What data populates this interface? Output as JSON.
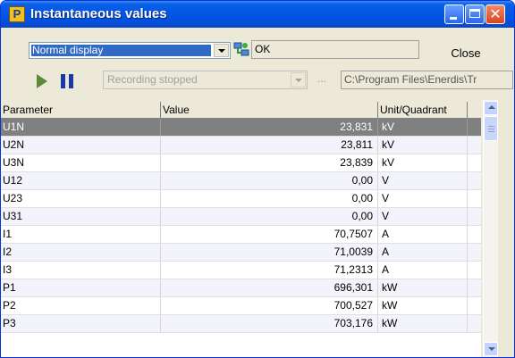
{
  "window": {
    "title": "Instantaneous values",
    "app_icon": "P"
  },
  "toolbar": {
    "display_mode": "Normal display",
    "status": "OK",
    "close_label": "Close",
    "recording_status": "Recording stopped",
    "browse_label": "...",
    "path": "C:\\Program Files\\Enerdis\\Tr"
  },
  "table": {
    "columns": [
      "Parameter",
      "Value",
      "Unit/Quadrant"
    ],
    "rows": [
      {
        "parameter": "U1N",
        "value": "23,831",
        "unit": "kV"
      },
      {
        "parameter": "U2N",
        "value": "23,811",
        "unit": "kV"
      },
      {
        "parameter": "U3N",
        "value": "23,839",
        "unit": "kV"
      },
      {
        "parameter": "U12",
        "value": "0,00",
        "unit": "V"
      },
      {
        "parameter": "U23",
        "value": "0,00",
        "unit": "V"
      },
      {
        "parameter": "U31",
        "value": "0,00",
        "unit": "V"
      },
      {
        "parameter": "I1",
        "value": "70,7507",
        "unit": "A"
      },
      {
        "parameter": "I2",
        "value": "71,0039",
        "unit": "A"
      },
      {
        "parameter": "I3",
        "value": "71,2313",
        "unit": "A"
      },
      {
        "parameter": "P1",
        "value": "696,301",
        "unit": "kW"
      },
      {
        "parameter": "P2",
        "value": "700,527",
        "unit": "kW"
      },
      {
        "parameter": "P3",
        "value": "703,176",
        "unit": "kW"
      }
    ]
  },
  "colors": {
    "title_bar": "#0558e6",
    "selected_row": "#808080",
    "selection_highlight": "#316ac5"
  }
}
